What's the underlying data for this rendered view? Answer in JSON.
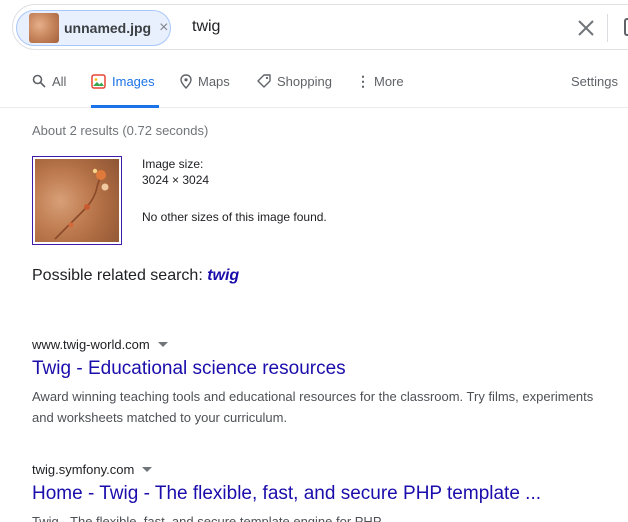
{
  "search": {
    "image_chip_label": "unnamed.jpg",
    "image_chip_close": "×",
    "query": "twig"
  },
  "tabs": [
    {
      "label": "All",
      "icon": "search-icon"
    },
    {
      "label": "Images",
      "icon": "images-icon",
      "active": true
    },
    {
      "label": "Maps",
      "icon": "map-pin-icon"
    },
    {
      "label": "Shopping",
      "icon": "tag-icon"
    },
    {
      "label": "More",
      "icon": "more-vert-icon"
    }
  ],
  "settings_label": "Settings",
  "stats": "About 2 results (0.72 seconds)",
  "image_info": {
    "size_label": "Image size:",
    "size_value": "3024 × 3024",
    "other_sizes": "No other sizes of this image found."
  },
  "related": {
    "prefix": "Possible related search: ",
    "term": "twig"
  },
  "results": [
    {
      "url": "www.twig-world.com",
      "title": "Twig - Educational science resources",
      "snippet": "Award winning teaching tools and educational resources for the classroom. Try films, experiments and worksheets matched to your curriculum."
    },
    {
      "url": "twig.symfony.com",
      "title": "Home - Twig - The flexible, fast, and secure PHP template ...",
      "snippet": "Twig - The flexible, fast, and secure template engine for PHP."
    }
  ],
  "colors": {
    "link": "#1a0dab",
    "active_tab": "#1a73e8",
    "chip_bg": "#e8f0fe"
  }
}
